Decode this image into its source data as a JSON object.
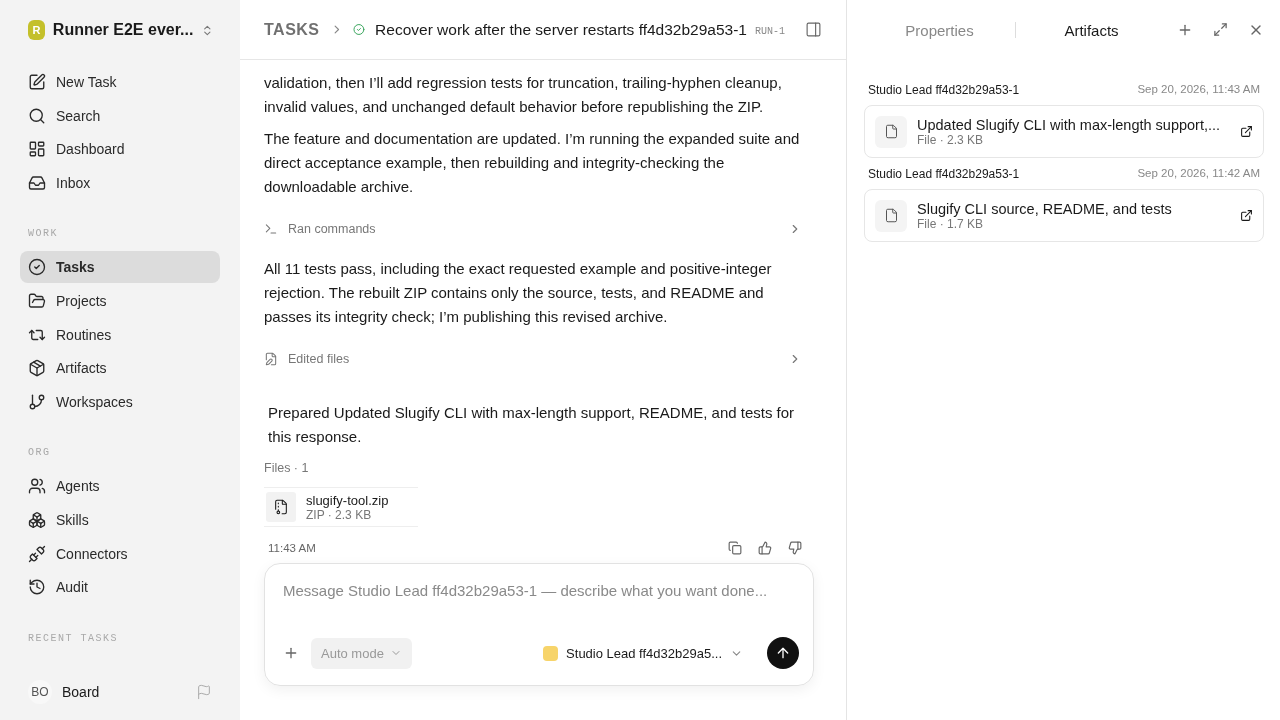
{
  "sidebar": {
    "workspace": {
      "initial": "R",
      "name": "Runner E2E ever..."
    },
    "top_items": [
      {
        "label": "New Task",
        "selected": false
      },
      {
        "label": "Search",
        "selected": false
      },
      {
        "label": "Dashboard",
        "selected": false
      },
      {
        "label": "Inbox",
        "selected": false
      }
    ],
    "sections": [
      {
        "title": "WORK",
        "items": [
          {
            "label": "Tasks",
            "selected": true
          },
          {
            "label": "Projects",
            "selected": false
          },
          {
            "label": "Routines",
            "selected": false
          },
          {
            "label": "Artifacts",
            "selected": false
          },
          {
            "label": "Workspaces",
            "selected": false
          }
        ]
      },
      {
        "title": "ORG",
        "items": [
          {
            "label": "Agents",
            "selected": false
          },
          {
            "label": "Skills",
            "selected": false
          },
          {
            "label": "Connectors",
            "selected": false
          },
          {
            "label": "Audit",
            "selected": false
          }
        ]
      },
      {
        "title": "RECENT TASKS"
      }
    ],
    "user": {
      "initials": "BO",
      "name": "Board"
    }
  },
  "header": {
    "breadcrumb": "TASKS",
    "title": "Recover work after the server restarts ff4d32b29a53-1",
    "run": "RUN-1"
  },
  "messages": [
    {
      "kind": "paragraph",
      "text": "validation, then I’ll add regression tests for truncation, trailing-hyphen cleanup, invalid values, and unchanged default behavior before republishing the ZIP."
    },
    {
      "kind": "paragraph",
      "text": "The feature and documentation are updated. I’m running the expanded suite and direct acceptance example, then rebuilding and integrity-checking the downloadable archive."
    },
    {
      "kind": "commands",
      "label": "Ran commands"
    },
    {
      "kind": "paragraph",
      "text": "All 11 tests pass, including the exact requested example and positive-integer rejection. The rebuilt ZIP contains only the source, tests, and README and passes its integrity check; I’m publishing this revised archive."
    },
    {
      "kind": "edits",
      "label": "Edited files"
    },
    {
      "kind": "summary",
      "text": "Prepared Updated Slugify CLI with max-length support, README, and tests for this response."
    }
  ],
  "files": {
    "label": "Files · 1",
    "items": [
      {
        "name": "slugify-tool.zip",
        "meta": "ZIP · 2.3 KB"
      }
    ]
  },
  "time": "11:43 AM",
  "composer": {
    "placeholder": "Message Studio Lead ff4d32b29a53-1 — describe what you want done...",
    "mode": "Auto mode",
    "agent": "Studio Lead ff4d32b29a5..."
  },
  "panel": {
    "tabs": [
      {
        "label": "Properties",
        "selected": false
      },
      {
        "label": "Artifacts",
        "selected": true
      }
    ],
    "artifacts": [
      {
        "author": "Studio Lead ff4d32b29a53-1",
        "date": "Sep 20, 2026, 11:43 AM",
        "title": "Updated Slugify CLI with max-length support,...",
        "meta": "File · 2.3 KB"
      },
      {
        "author": "Studio Lead ff4d32b29a53-1",
        "date": "Sep 20, 2026, 11:42 AM",
        "title": "Slugify CLI source, README, and tests",
        "meta": "File · 1.7 KB"
      }
    ]
  }
}
